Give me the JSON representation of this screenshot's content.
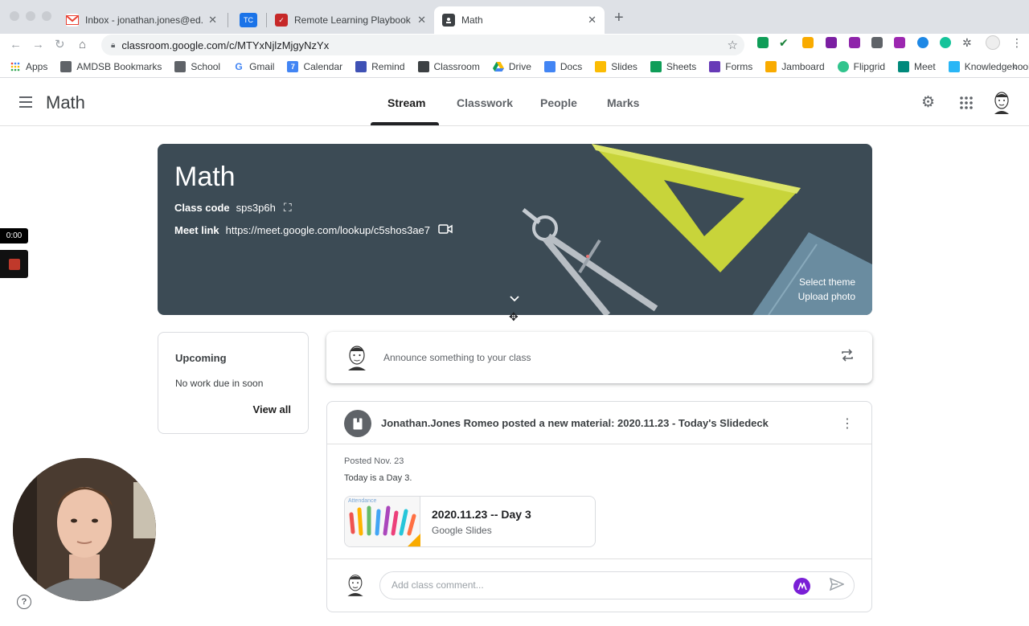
{
  "browser": {
    "tabs": [
      {
        "title": "Inbox - jonathan.jones@ed.amdsb.ca",
        "active": false
      },
      {
        "title": "TC",
        "active": false
      },
      {
        "title": "Remote Learning Playbook",
        "active": false
      },
      {
        "title": "Math",
        "active": true
      }
    ],
    "url": "classroom.google.com/c/MTYxNjlzMjgyNzYx",
    "bookmarks": [
      "Apps",
      "AMDSB Bookmarks",
      "School",
      "Gmail",
      "Calendar",
      "Remind",
      "Classroom",
      "Drive",
      "Docs",
      "Slides",
      "Sheets",
      "Forms",
      "Jamboard",
      "Flipgrid",
      "Meet",
      "Knowledgehook"
    ],
    "bookmarks_more": "»"
  },
  "header": {
    "title": "Math",
    "tabs": [
      "Stream",
      "Classwork",
      "People",
      "Marks"
    ],
    "active_tab": "Stream"
  },
  "banner": {
    "title": "Math",
    "class_code_label": "Class code",
    "class_code": "sps3p6h",
    "meet_link_label": "Meet link",
    "meet_link": "https://meet.google.com/lookup/c5shos3ae7",
    "select_theme": "Select theme",
    "upload_photo": "Upload photo"
  },
  "upcoming": {
    "heading": "Upcoming",
    "text": "No work due in soon",
    "view_all": "View all"
  },
  "announce": {
    "placeholder": "Announce something to your class"
  },
  "post": {
    "title": "Jonathan.Jones Romeo posted a new material: 2020.11.23 - Today's Slidedeck",
    "date": "Posted Nov. 23",
    "body": "Today is a Day 3.",
    "attachment": {
      "name": "2020.11.23 -- Day 3",
      "type": "Google Slides",
      "thumb_label": "Attendance"
    },
    "comment_placeholder": "Add class comment..."
  },
  "recorder": {
    "timer": "0:00"
  },
  "colors": {
    "banner_bg": "#3c4b55",
    "accent": "#1a73e8",
    "comment_badge": "#7a1fd6"
  }
}
